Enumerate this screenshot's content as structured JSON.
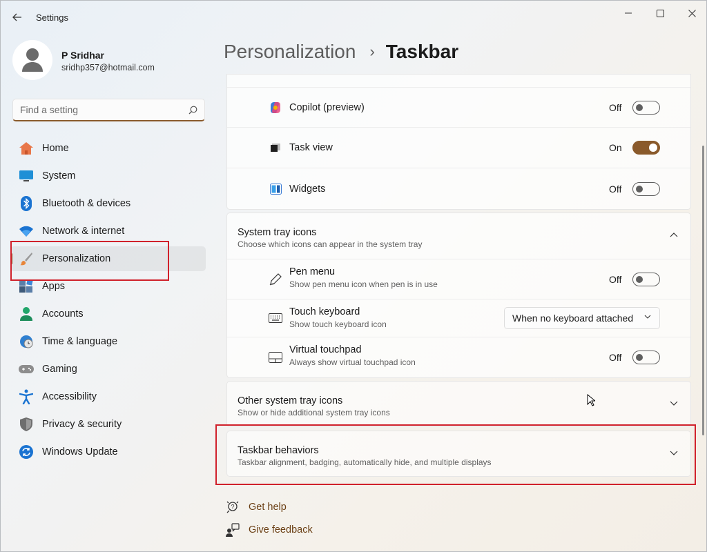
{
  "app": {
    "title": "Settings"
  },
  "user": {
    "name": "P Sridhar",
    "email": "sridhp357@hotmail.com"
  },
  "search": {
    "placeholder": "Find a setting"
  },
  "nav": {
    "items": [
      {
        "label": "Home",
        "icon": "home-icon"
      },
      {
        "label": "System",
        "icon": "monitor-icon"
      },
      {
        "label": "Bluetooth & devices",
        "icon": "bluetooth-icon"
      },
      {
        "label": "Network & internet",
        "icon": "wifi-icon"
      },
      {
        "label": "Personalization",
        "icon": "brush-icon",
        "active": true
      },
      {
        "label": "Apps",
        "icon": "apps-icon"
      },
      {
        "label": "Accounts",
        "icon": "person-icon"
      },
      {
        "label": "Time & language",
        "icon": "globe-clock-icon"
      },
      {
        "label": "Gaming",
        "icon": "gamepad-icon"
      },
      {
        "label": "Accessibility",
        "icon": "accessibility-icon"
      },
      {
        "label": "Privacy & security",
        "icon": "shield-icon"
      },
      {
        "label": "Windows Update",
        "icon": "update-icon"
      }
    ]
  },
  "breadcrumb": {
    "parent": "Personalization",
    "separator": "›",
    "current": "Taskbar"
  },
  "taskbar_items": [
    {
      "label": "Copilot (preview)",
      "state": "Off",
      "on": false,
      "icon": "copilot-icon"
    },
    {
      "label": "Task view",
      "state": "On",
      "on": true,
      "icon": "task-view-icon"
    },
    {
      "label": "Widgets",
      "state": "Off",
      "on": false,
      "icon": "widgets-icon"
    }
  ],
  "system_tray": {
    "title": "System tray icons",
    "subtitle": "Choose which icons can appear in the system tray",
    "items": [
      {
        "title": "Pen menu",
        "subtitle": "Show pen menu icon when pen is in use",
        "state": "Off",
        "on": false,
        "icon": "pen-icon"
      },
      {
        "title": "Touch keyboard",
        "subtitle": "Show touch keyboard icon",
        "dropdown": "When no keyboard attached",
        "icon": "keyboard-icon"
      },
      {
        "title": "Virtual touchpad",
        "subtitle": "Always show virtual touchpad icon",
        "state": "Off",
        "on": false,
        "icon": "touchpad-icon"
      }
    ]
  },
  "other_tray": {
    "title": "Other system tray icons",
    "subtitle": "Show or hide additional system tray icons"
  },
  "behaviors": {
    "title": "Taskbar behaviors",
    "subtitle": "Taskbar alignment, badging, automatically hide, and multiple displays"
  },
  "help": {
    "get_help": "Get help",
    "give_feedback": "Give feedback"
  },
  "colors": {
    "accent": "#8a5a2b",
    "annotation": "#d0212b",
    "link": "#6a3f14"
  }
}
